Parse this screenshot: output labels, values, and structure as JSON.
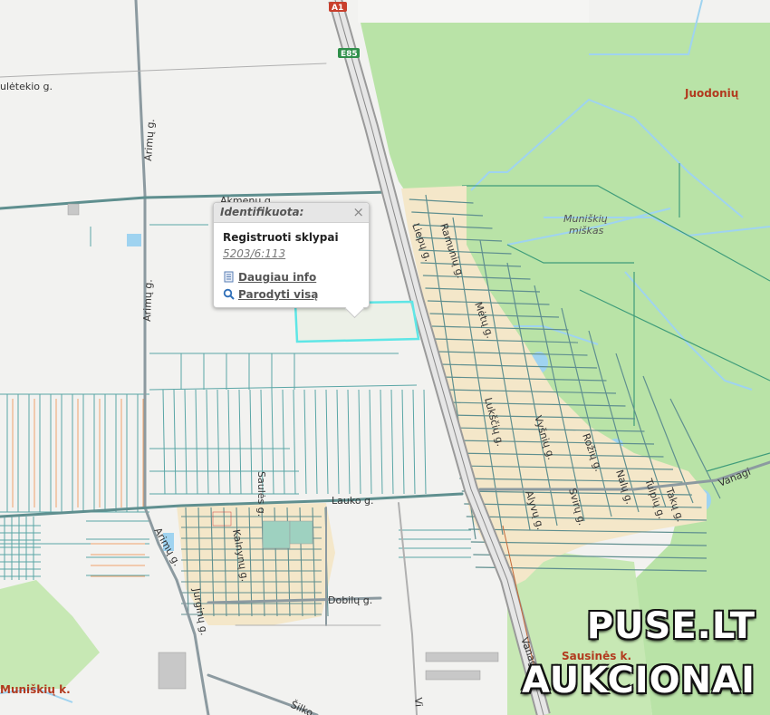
{
  "popup": {
    "title": "Identifikuota:",
    "close_symbol": "×",
    "layer": "Registruoti sklypai",
    "parcel_code": "5203/6:113",
    "more_info": "Daugiau info",
    "show_all": "Parodyti visą"
  },
  "labels": {
    "streets": {
      "sauletekio": "ulėtekio g.",
      "arimu_top": "Arimų g.",
      "akmenu": "Akmenų g.",
      "arimu_mid": "Arimų g.",
      "liepu": "Liepų g.",
      "ramunu": "Ramunių g.",
      "metu": "Mėtų g.",
      "luksciu": "Lukščių g.",
      "visniu": "Vyšnių g.",
      "rozu": "Rožių g.",
      "naciu": "Nalų g.",
      "tulpiu": "Tulpių g.",
      "alyvu": "Alyvų g.",
      "sviru": "Svirų g.",
      "taku": "Takų g.",
      "lauko": "Lauko g.",
      "saules": "Saulės g.",
      "kalnynu": "Kalnynų g.",
      "arimu_bot": "Arimų g.",
      "jurginu": "Jurginų g.",
      "dobilu": "Dobilų g.",
      "silko": "Šilko",
      "vanagi_bot": "Vanagi",
      "vanagi_right": "Vanagi",
      "vi": "Vi"
    },
    "places": {
      "juodoniu": "Juodonių",
      "muniskiu_miskas_1": "Muniškių",
      "muniskiu_miskas_2": "miškas",
      "muniskiu_k": "Muniškių k.",
      "sausines_k": "Sausinės k."
    },
    "shields": {
      "a1": "A1",
      "e85": "E85"
    }
  },
  "watermark": {
    "line1": "PUSE.LT",
    "line2": "AUKCIONAI"
  },
  "colors": {
    "forest": "#b9e3a7",
    "road_outline": "#5f8f8f",
    "parcel_line": "#5aa6a6",
    "settlement_fill": "#f4e7c9",
    "highlight": "#5ee6e6",
    "water": "#9fd3f0",
    "place_label": "#b23a1e"
  }
}
